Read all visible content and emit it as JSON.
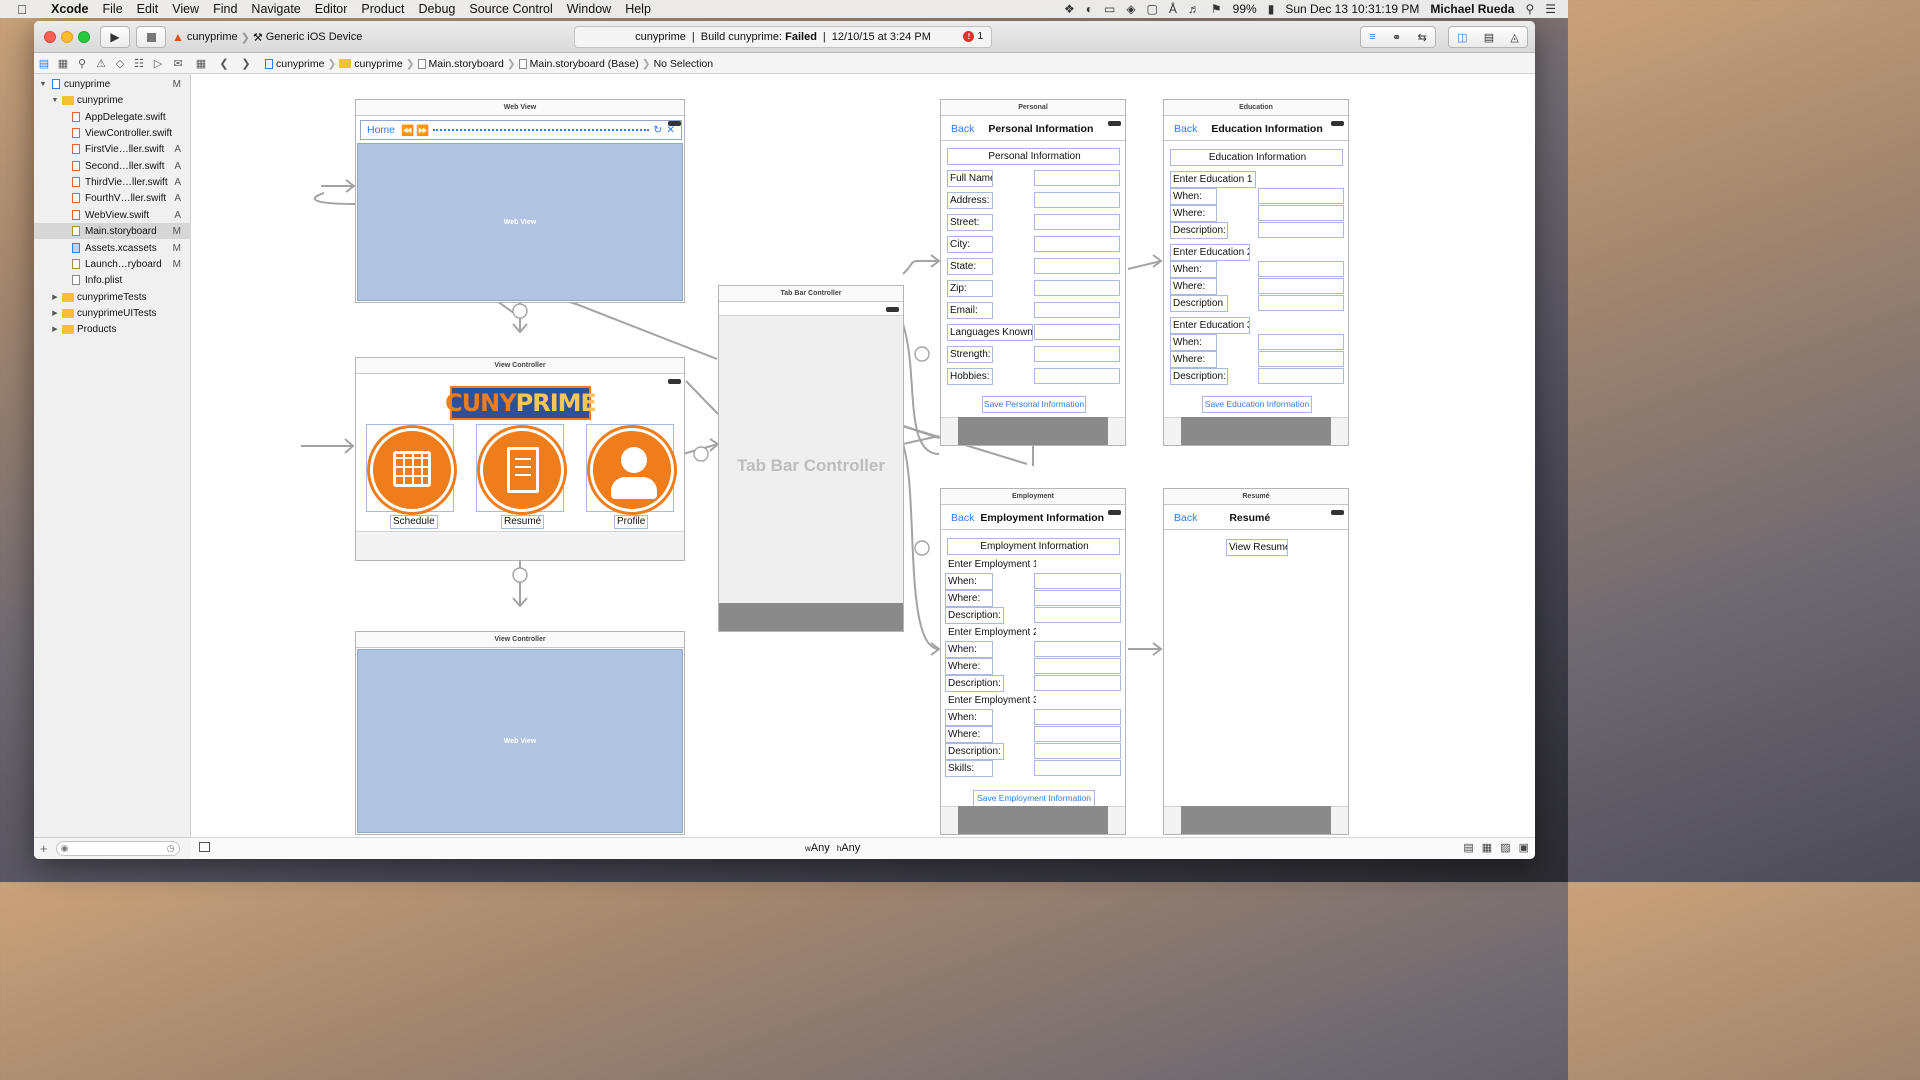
{
  "menubar": {
    "items": [
      "Xcode",
      "File",
      "Edit",
      "View",
      "Find",
      "Navigate",
      "Editor",
      "Product",
      "Debug",
      "Source Control",
      "Window",
      "Help"
    ],
    "battery": "99%",
    "datetime": "Sun Dec 13  10:31:19 PM",
    "user": "Michael Rueda"
  },
  "toolbar": {
    "scheme": "cunyprime",
    "device": "Generic iOS Device",
    "activity_project": "cunyprime",
    "activity_prefix": "Build cunyprime:",
    "activity_status": "Failed",
    "activity_time": "12/10/15 at 3:24 PM",
    "error_count": "1"
  },
  "breadcrumb": [
    "cunyprime",
    "cunyprime",
    "Main.storyboard",
    "Main.storyboard (Base)",
    "No Selection"
  ],
  "navigator": {
    "rows": [
      {
        "label": "cunyprime",
        "badge": "M"
      },
      {
        "label": "cunyprime",
        "badge": ""
      },
      {
        "label": "AppDelegate.swift",
        "badge": ""
      },
      {
        "label": "ViewController.swift",
        "badge": ""
      },
      {
        "label": "FirstVie…ller.swift",
        "badge": "A"
      },
      {
        "label": "Second…ller.swift",
        "badge": "A"
      },
      {
        "label": "ThirdVie…ller.swift",
        "badge": "A"
      },
      {
        "label": "FourthV…ller.swift",
        "badge": "A"
      },
      {
        "label": "WebView.swift",
        "badge": "A"
      },
      {
        "label": "Main.storyboard",
        "badge": "M"
      },
      {
        "label": "Assets.xcassets",
        "badge": "M"
      },
      {
        "label": "Launch…ryboard",
        "badge": "M"
      },
      {
        "label": "Info.plist",
        "badge": ""
      },
      {
        "label": "cunyprimeTests",
        "badge": ""
      },
      {
        "label": "cunyprimeUITests",
        "badge": ""
      },
      {
        "label": "Products",
        "badge": ""
      }
    ]
  },
  "sizeclass": {
    "w": "w",
    "wval": "Any",
    "h": "h",
    "hval": "Any"
  },
  "storyboard": {
    "webview_top": {
      "title": "Web View",
      "home": "Home",
      "content": "Web View"
    },
    "vc_main": {
      "title": "View Controller",
      "logo_a": "CUNY",
      "logo_b": "PRIME",
      "schedule": "Schedule",
      "resume": "Resumé",
      "profile": "Profile"
    },
    "vc_bottom": {
      "title": "View Controller",
      "content": "Web View"
    },
    "tabbar": {
      "title": "Tab Bar Controller",
      "label": "Tab Bar Controller"
    },
    "personal": {
      "title": "Personal",
      "back": "Back",
      "nav_title": "Personal Information",
      "header": "Personal Information",
      "labels": [
        "Full Name:",
        "Address:",
        "Street:",
        "City:",
        "State:",
        "Zip:",
        "Email:",
        "Languages Known:",
        "Strength:",
        "Hobbies:"
      ],
      "save": "Save Personal Information"
    },
    "education": {
      "title": "Education",
      "back": "Back",
      "nav_title": "Education Information",
      "header": "Education Information",
      "groups": [
        {
          "title": "Enter Education 1",
          "labels": [
            "When:",
            "Where:",
            "Description:"
          ]
        },
        {
          "title": "Enter Education 2",
          "labels": [
            "When:",
            "Where:",
            "Description"
          ]
        },
        {
          "title": "Enter Education 3",
          "labels": [
            "When:",
            "Where:",
            "Description:"
          ]
        }
      ],
      "save": "Save Education Information"
    },
    "employment": {
      "title": "Employment",
      "back": "Back",
      "nav_title": "Employment Information",
      "header": "Employment Information",
      "groups": [
        {
          "title": "Enter Employment 1",
          "labels": [
            "When:",
            "Where:",
            "Description:"
          ]
        },
        {
          "title": "Enter Employment 2",
          "labels": [
            "When:",
            "Where:",
            "Description:"
          ]
        },
        {
          "title": "Enter Employment 3",
          "labels": [
            "When:",
            "Where:",
            "Description:",
            "Skills:"
          ]
        }
      ],
      "save": "Save Employment Information"
    },
    "resume": {
      "title": "Resumé",
      "back": "Back",
      "nav_title": "Resumé",
      "button": "View Resumé"
    }
  }
}
